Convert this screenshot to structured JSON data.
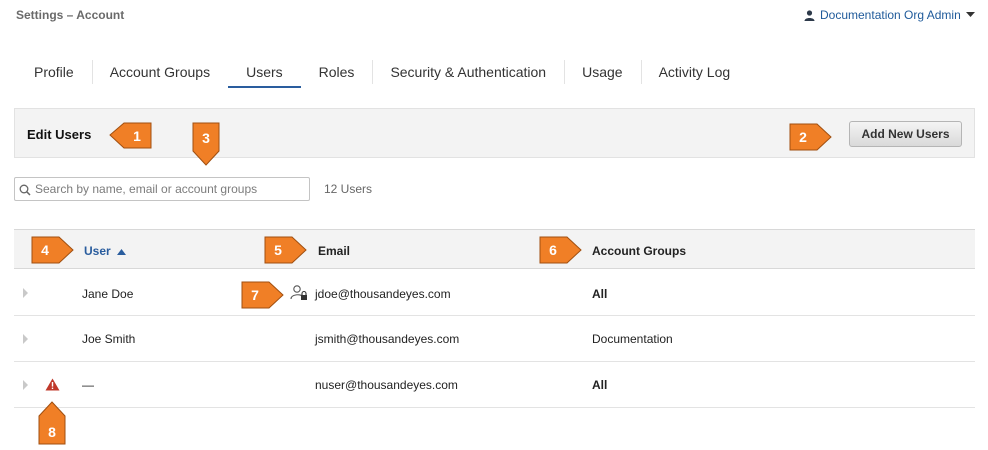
{
  "breadcrumb": "Settings – Account",
  "user_menu": {
    "label": "Documentation Org Admin"
  },
  "tabs": [
    {
      "label": "Profile"
    },
    {
      "label": "Account Groups"
    },
    {
      "label": "Users",
      "active": true
    },
    {
      "label": "Roles"
    },
    {
      "label": "Security & Authentication"
    },
    {
      "label": "Usage"
    },
    {
      "label": "Activity Log"
    }
  ],
  "edit_section": {
    "title": "Edit Users",
    "add_button": "Add New Users"
  },
  "search": {
    "placeholder": "Search by name, email or account groups",
    "value": ""
  },
  "user_count": "12 Users",
  "table": {
    "headers": {
      "user": "User",
      "email": "Email",
      "account_groups": "Account Groups"
    },
    "sort": {
      "column": "user",
      "direction": "ascending"
    },
    "rows": [
      {
        "user": "Jane Doe",
        "email": "jdoe@thousandeyes.com",
        "account_groups": "All",
        "icon": "user-lock-icon"
      },
      {
        "user": "Joe Smith",
        "email": "jsmith@thousandeyes.com",
        "account_groups": "Documentation"
      },
      {
        "user": "—",
        "email": "nuser@thousandeyes.com",
        "account_groups": "All",
        "icon": "warning-icon"
      }
    ]
  },
  "callouts": [
    "1",
    "2",
    "3",
    "4",
    "5",
    "6",
    "7",
    "8"
  ],
  "colors": {
    "accent": "#2a5d9e",
    "callout": "#f07f26",
    "warning": "#c0392b"
  }
}
